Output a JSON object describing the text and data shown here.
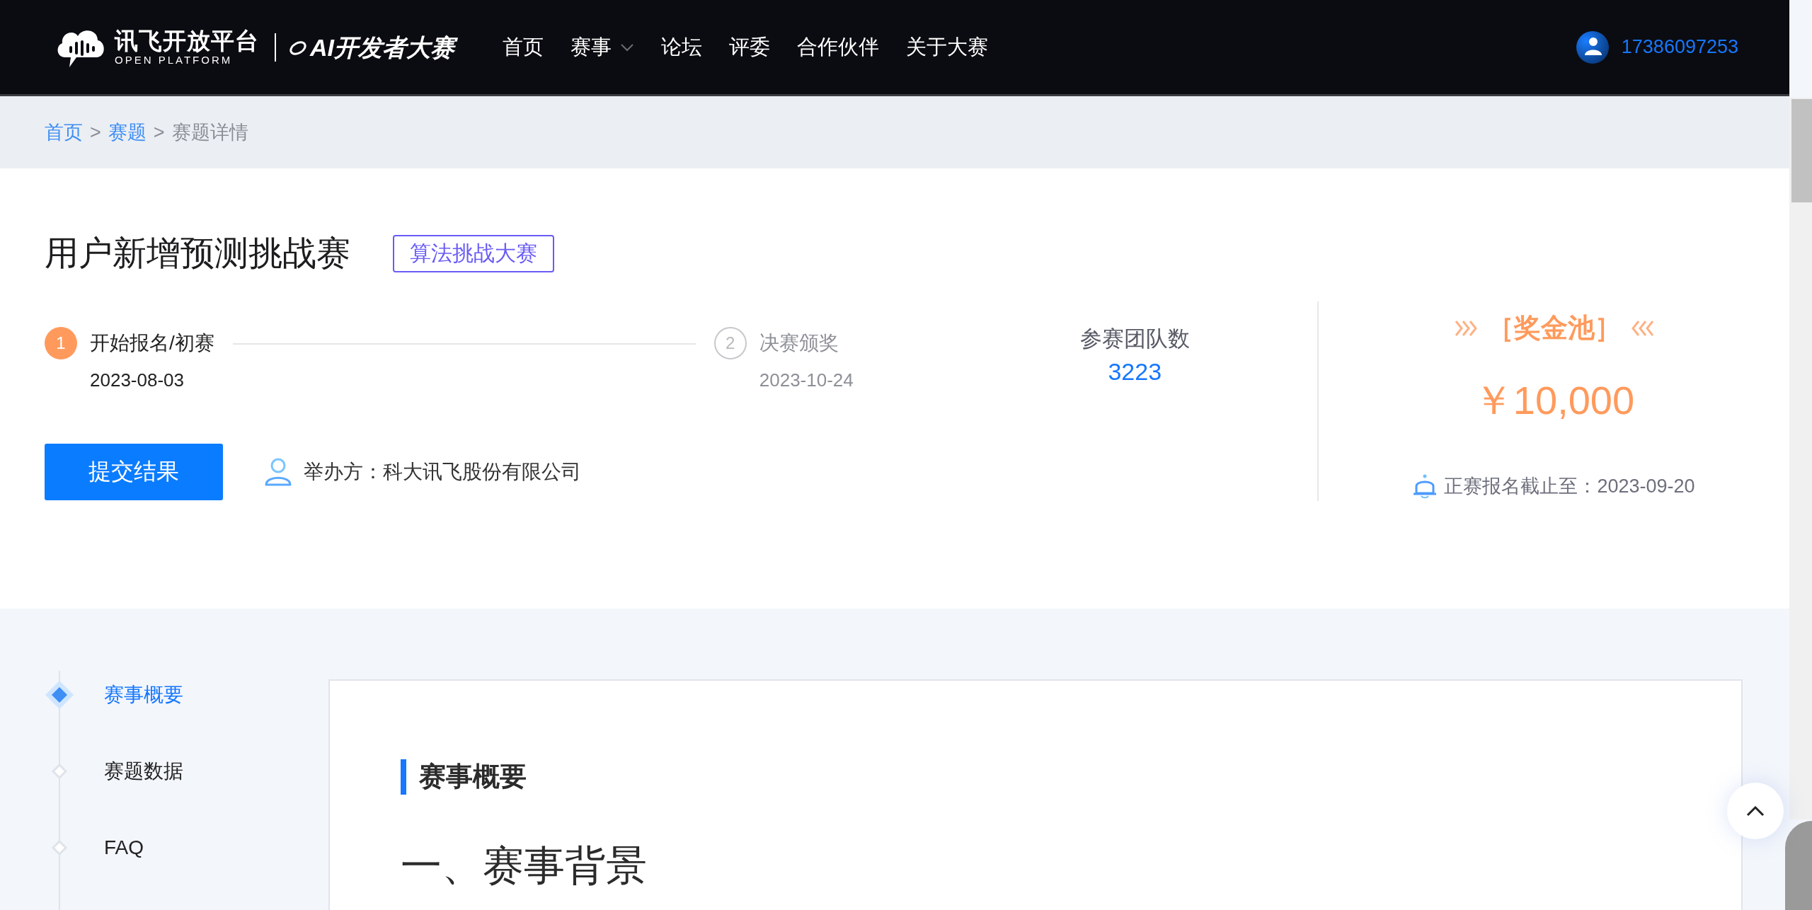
{
  "header": {
    "logo_title": "讯飞开放平台",
    "logo_subtitle": "OPEN PLATFORM",
    "brand": "AI开发者大赛",
    "nav": [
      {
        "label": "首页",
        "kind": "link"
      },
      {
        "label": "赛事",
        "kind": "dropdown"
      },
      {
        "label": "论坛",
        "kind": "link"
      },
      {
        "label": "评委",
        "kind": "link"
      },
      {
        "label": "合作伙伴",
        "kind": "link"
      },
      {
        "label": "关于大赛",
        "kind": "link"
      }
    ],
    "user": "17386097253"
  },
  "breadcrumb": {
    "separator": ">",
    "items": [
      {
        "label": "首页",
        "link": true
      },
      {
        "label": "赛题",
        "link": true
      },
      {
        "label": "赛题详情",
        "link": false
      }
    ]
  },
  "competition": {
    "title": "用户新增预测挑战赛",
    "tag": "算法挑战大赛",
    "steps": [
      {
        "number": "1",
        "label": "开始报名/初赛",
        "date": "2023-08-03",
        "active": true
      },
      {
        "number": "2",
        "label": "决赛颁奖",
        "date": "2023-10-24",
        "active": false
      }
    ],
    "teams": {
      "label": "参赛团队数",
      "value": "3223"
    },
    "submit_button": "提交结果",
    "organizer": "举办方：科大讯飞股份有限公司"
  },
  "prize": {
    "label": "［奖金池］",
    "amount": "￥10,000",
    "deadline": "正赛报名截止至：2023-09-20"
  },
  "sidebar": {
    "items": [
      {
        "label": "赛事概要",
        "selected": true
      },
      {
        "label": "赛题数据",
        "selected": false
      },
      {
        "label": "FAQ",
        "selected": false
      }
    ]
  },
  "content": {
    "section_title": "赛事概要",
    "heading": "一、赛事背景"
  }
}
